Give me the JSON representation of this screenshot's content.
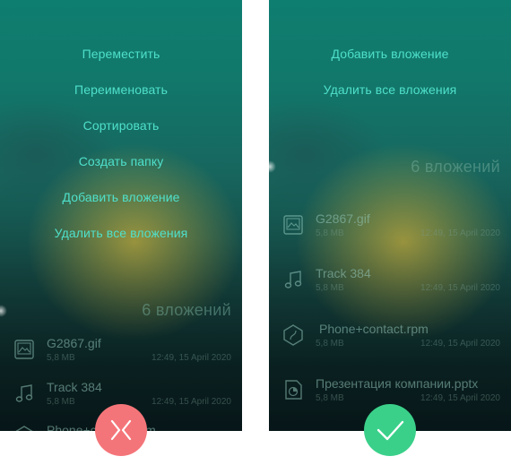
{
  "colors": {
    "menu_text": "#4fe0cb",
    "wrong_badge": "#f47579",
    "right_badge": "#3ad08a"
  },
  "left_screen": {
    "menu": [
      "Переместить",
      "Переименовать",
      "Сортировать",
      "Создать папку",
      "Добавить вложение",
      "Удалить все вложения"
    ],
    "section_header": "6 вложений",
    "files": [
      {
        "name": "G2867.gif",
        "size": "5,8 MB",
        "date": "12:49, 15 April 2020",
        "icon": "image-file-icon"
      },
      {
        "name": "Track 384",
        "size": "5,8 MB",
        "date": "12:49, 15 April 2020",
        "icon": "music-note-icon"
      },
      {
        "name": "Phone+contact.rpm",
        "icon": "app-file-icon"
      }
    ],
    "badge_icon": "cross-icon"
  },
  "right_screen": {
    "menu": [
      "Добавить вложение",
      "Удалить все вложения"
    ],
    "section_header": "6 вложений",
    "files": [
      {
        "name": "G2867.gif",
        "size": "5,8 MB",
        "date": "12:49, 15 April 2020",
        "icon": "image-file-icon"
      },
      {
        "name": "Track 384",
        "size": "5,8 MB",
        "date": "12:49, 15 April 2020",
        "icon": "music-note-icon"
      },
      {
        "name": "Phone+contact.rpm",
        "size": "5,8 MB",
        "date": "12:49, 15 April 2020",
        "icon": "app-file-icon"
      },
      {
        "name": "Презентация компании.pptx",
        "size": "5,8 MB",
        "date": "12:49, 15 April 2020",
        "icon": "presentation-file-icon"
      }
    ],
    "badge_icon": "check-icon"
  }
}
